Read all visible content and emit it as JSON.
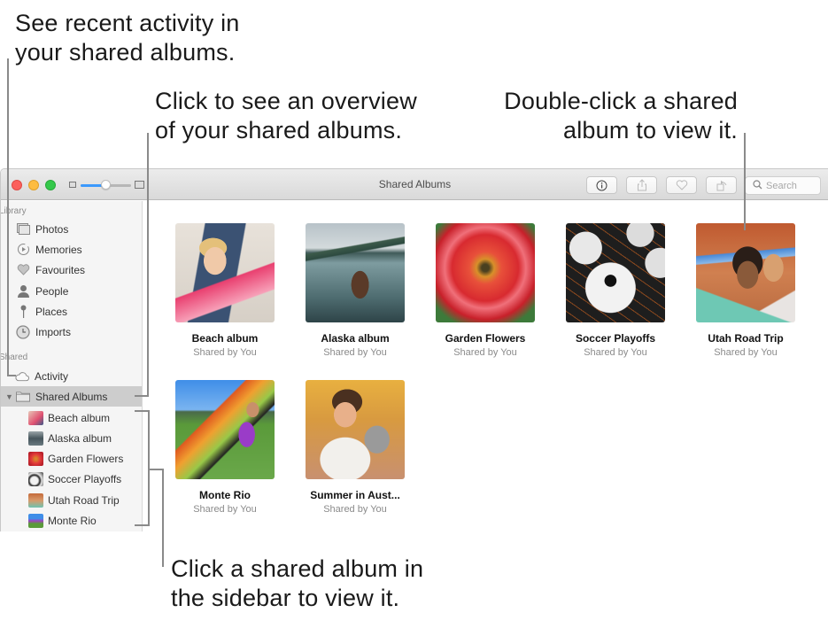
{
  "callouts": {
    "activity": [
      "See recent activity in",
      "your shared albums."
    ],
    "overview": [
      "Click to see an overview",
      "of your shared albums."
    ],
    "double_click": [
      "Double-click a shared",
      "album to view it."
    ],
    "sidebar": [
      "Click a shared album in",
      "the sidebar to view it."
    ]
  },
  "window": {
    "title": "Shared Albums",
    "zoom_slider_value": 0.5,
    "toolbar": {
      "info_icon": "info-icon",
      "share_icon": "share-icon",
      "favourite_icon": "heart-icon",
      "rotate_icon": "rotate-icon",
      "search_placeholder": "Search"
    }
  },
  "sidebar": {
    "library_title": "Library",
    "library_items": [
      {
        "label": "Photos",
        "icon": "photos-icon"
      },
      {
        "label": "Memories",
        "icon": "memories-icon"
      },
      {
        "label": "Favourites",
        "icon": "heart-icon"
      },
      {
        "label": "People",
        "icon": "person-icon"
      },
      {
        "label": "Places",
        "icon": "pin-icon"
      },
      {
        "label": "Imports",
        "icon": "clock-icon"
      }
    ],
    "shared_title": "Shared",
    "shared_items": [
      {
        "label": "Activity",
        "icon": "cloud-icon"
      },
      {
        "label": "Shared Albums",
        "icon": "folder-icon",
        "selected": true,
        "expanded": true
      }
    ],
    "albums": [
      {
        "label": "Beach album"
      },
      {
        "label": "Alaska album"
      },
      {
        "label": "Garden Flowers"
      },
      {
        "label": "Soccer Playoffs"
      },
      {
        "label": "Utah Road Trip"
      },
      {
        "label": "Monte Rio"
      }
    ]
  },
  "albums": [
    {
      "name": "Beach album",
      "subtitle": "Shared by You"
    },
    {
      "name": "Alaska album",
      "subtitle": "Shared by You"
    },
    {
      "name": "Garden Flowers",
      "subtitle": "Shared by You"
    },
    {
      "name": "Soccer Playoffs",
      "subtitle": "Shared by You"
    },
    {
      "name": "Utah Road Trip",
      "subtitle": "Shared by You"
    },
    {
      "name": "Monte Rio",
      "subtitle": "Shared by You"
    },
    {
      "name": "Summer in Aust...",
      "subtitle": "Shared by You"
    }
  ]
}
